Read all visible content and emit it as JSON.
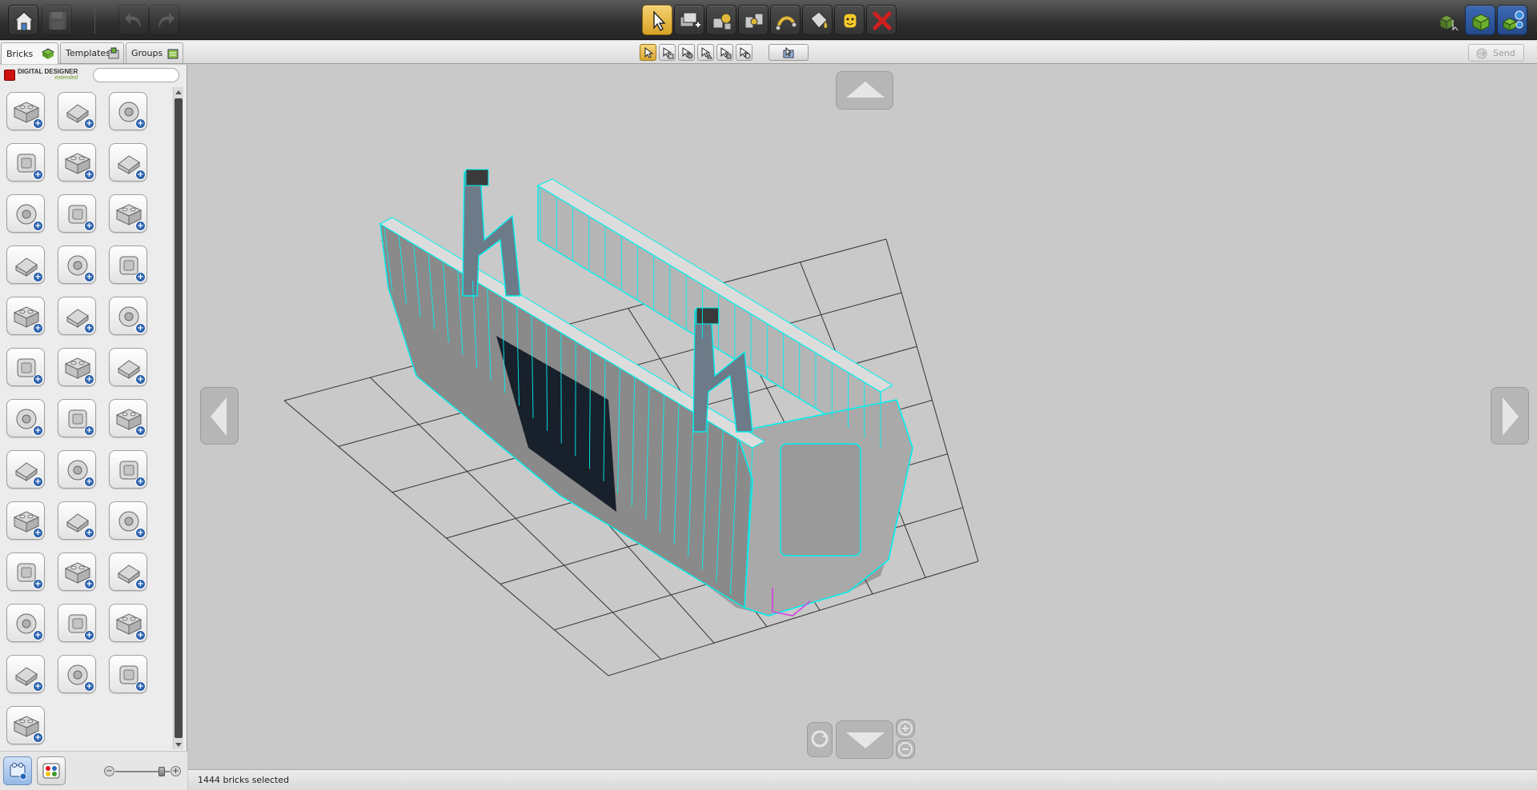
{
  "app": {
    "brand": "DIGITAL DESIGNER",
    "brand_sub": "extended"
  },
  "toolbar": {
    "left": [
      {
        "name": "home-button",
        "icon": "home-icon",
        "disabled": false
      },
      {
        "name": "save-button",
        "icon": "save-icon",
        "disabled": true
      },
      {
        "name": "undo-button",
        "icon": "undo-icon",
        "disabled": true
      },
      {
        "name": "redo-button",
        "icon": "redo-icon",
        "disabled": true
      }
    ],
    "center": [
      {
        "name": "select-tool-button",
        "icon": "cursor-icon",
        "active": true
      },
      {
        "name": "clone-tool-button",
        "icon": "clone-icon",
        "active": false
      },
      {
        "name": "hinge-tool-button",
        "icon": "hinge-icon",
        "active": false
      },
      {
        "name": "hinge-align-tool-button",
        "icon": "hinge-align-icon",
        "active": false
      },
      {
        "name": "flex-tool-button",
        "icon": "flex-icon",
        "active": false
      },
      {
        "name": "paint-tool-button",
        "icon": "paint-bucket-icon",
        "active": false
      },
      {
        "name": "decoration-tool-button",
        "icon": "minifig-head-icon",
        "active": false
      },
      {
        "name": "delete-tool-button",
        "icon": "delete-x-icon",
        "active": false
      }
    ],
    "right": [
      {
        "name": "build-mode-button",
        "icon": "build-mode-icon"
      },
      {
        "name": "view-mode-button",
        "icon": "view-mode-icon"
      },
      {
        "name": "building-guide-button",
        "icon": "building-guide-icon"
      }
    ]
  },
  "tabs": [
    {
      "label": "Bricks",
      "active": true
    },
    {
      "label": "Templates",
      "active": false
    },
    {
      "label": "Groups",
      "active": false
    }
  ],
  "send": {
    "label": "Send"
  },
  "search": {
    "placeholder": ""
  },
  "collapse_label": "«",
  "palette": {
    "bricks": [
      "brick-2x2-icon",
      "brick-round-icon",
      "brick-1x1-icon",
      "brick-2x4-icon",
      "slope-brick-icon",
      "wedge-brick-icon",
      "arch-brick-icon",
      "plate-2x2-icon",
      "plate-2x3-icon",
      "connector-plate-icon",
      "corner-brick-icon",
      "door-panel-icon",
      "wheel-tire-icon",
      "motor-icon",
      "technic-beam-icon",
      "technic-liftarm-icon",
      "axle-pin-icon",
      "gear-icon",
      "curved-slope-icon",
      "cylinder-icon",
      "tile-icon",
      "wrench-tool-icon",
      "minifig-accessory-icon",
      "ring-holder-icon",
      "antenna-icon",
      "ships-wheel-icon",
      "track-link-icon",
      "cannon-icon",
      "minifig-body-icon",
      "minifig-head-icon",
      "helmet-icon",
      "hat-icon",
      "skeleton-icon",
      "torso-icon",
      "hammer-icon",
      "binoculars-icon",
      "animal-figure-icon"
    ]
  },
  "panel_bottom": {
    "zoom_minus": "−",
    "zoom_plus": "+",
    "zoom_level": 0.85
  },
  "status": {
    "text": "1444 bricks selected"
  },
  "colors": {
    "accent": "#e7b642",
    "wireframe": "#00f0f0",
    "viewport_bg": "#c9c9c9",
    "delete": "#d11e1e"
  }
}
